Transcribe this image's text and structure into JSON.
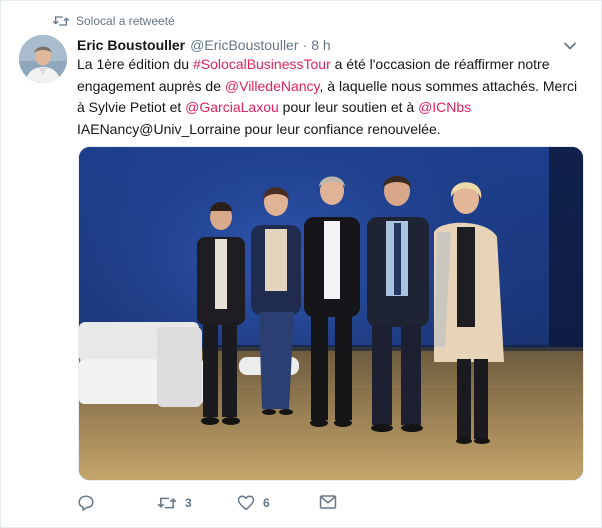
{
  "retweet_context": {
    "text": "Solocal a retweeté",
    "icon": "retweet-icon"
  },
  "tweet": {
    "author_name": "Eric Boustouller",
    "author_handle": "@EricBoustouller",
    "separator": "·",
    "timestamp": "8 h",
    "body": {
      "t1": "La 1ère édition du ",
      "l1": "#SolocalBusinessTour",
      "t2": " a été l'occasion de réaffirmer notre engagement auprès de ",
      "l2": "@VilledeNancy",
      "t3": ", à laquelle nous sommes attachés. Merci à Sylvie Petiot et ",
      "l3": "@GarciaLaxou",
      "t4": " pour leur soutien et à ",
      "l4": "@ICNbs",
      "t5": " IAENancy@Univ_Lorraine pour leur confiance renouvelée."
    },
    "link_color": "#e0245e"
  },
  "actions": {
    "reply": {
      "icon": "reply-icon",
      "count": ""
    },
    "retweet": {
      "icon": "retweet-icon",
      "count": "3"
    },
    "like": {
      "icon": "heart-icon",
      "count": "6"
    },
    "dm": {
      "icon": "envelope-icon"
    }
  },
  "colors": {
    "secondary_text": "#657786",
    "primary_text": "#14171a",
    "border": "#e6ecf0"
  }
}
